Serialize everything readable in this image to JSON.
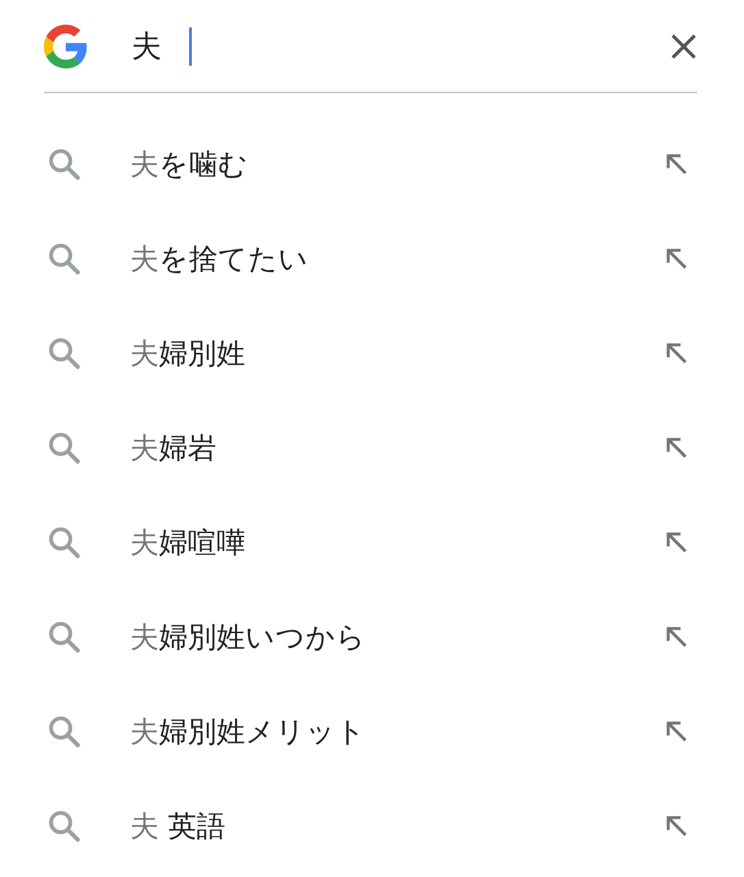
{
  "search": {
    "value": "夫"
  },
  "suggestions": [
    {
      "typed": "夫",
      "completion": "を噛む"
    },
    {
      "typed": "夫",
      "completion": "を捨てたい"
    },
    {
      "typed": "夫",
      "completion": "婦別姓"
    },
    {
      "typed": "夫",
      "completion": "婦岩"
    },
    {
      "typed": "夫",
      "completion": "婦喧嘩"
    },
    {
      "typed": "夫",
      "completion": "婦別姓いつから"
    },
    {
      "typed": "夫",
      "completion": "婦別姓メリット"
    },
    {
      "typed": "夫",
      "completion": " 英語"
    }
  ]
}
